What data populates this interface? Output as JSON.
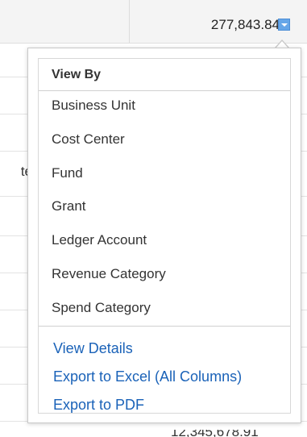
{
  "header": {
    "value": "277,843.84",
    "toggle_icon": "chevron-down-icon"
  },
  "background": {
    "partial_row_text": "te",
    "bottom_peek_text": "12,345,678.91"
  },
  "popup": {
    "section_title": "View By",
    "view_by_items": [
      {
        "label": "Business Unit"
      },
      {
        "label": "Cost Center"
      },
      {
        "label": "Fund"
      },
      {
        "label": "Grant"
      },
      {
        "label": "Ledger Account"
      },
      {
        "label": "Revenue Category"
      },
      {
        "label": "Spend Category"
      }
    ],
    "actions": [
      {
        "label": "View Details"
      },
      {
        "label": "Export to Excel (All Columns)"
      },
      {
        "label": "Export to PDF"
      }
    ]
  },
  "colors": {
    "link": "#1a62b8",
    "toggle": "#66a6e8",
    "text": "#333333"
  }
}
